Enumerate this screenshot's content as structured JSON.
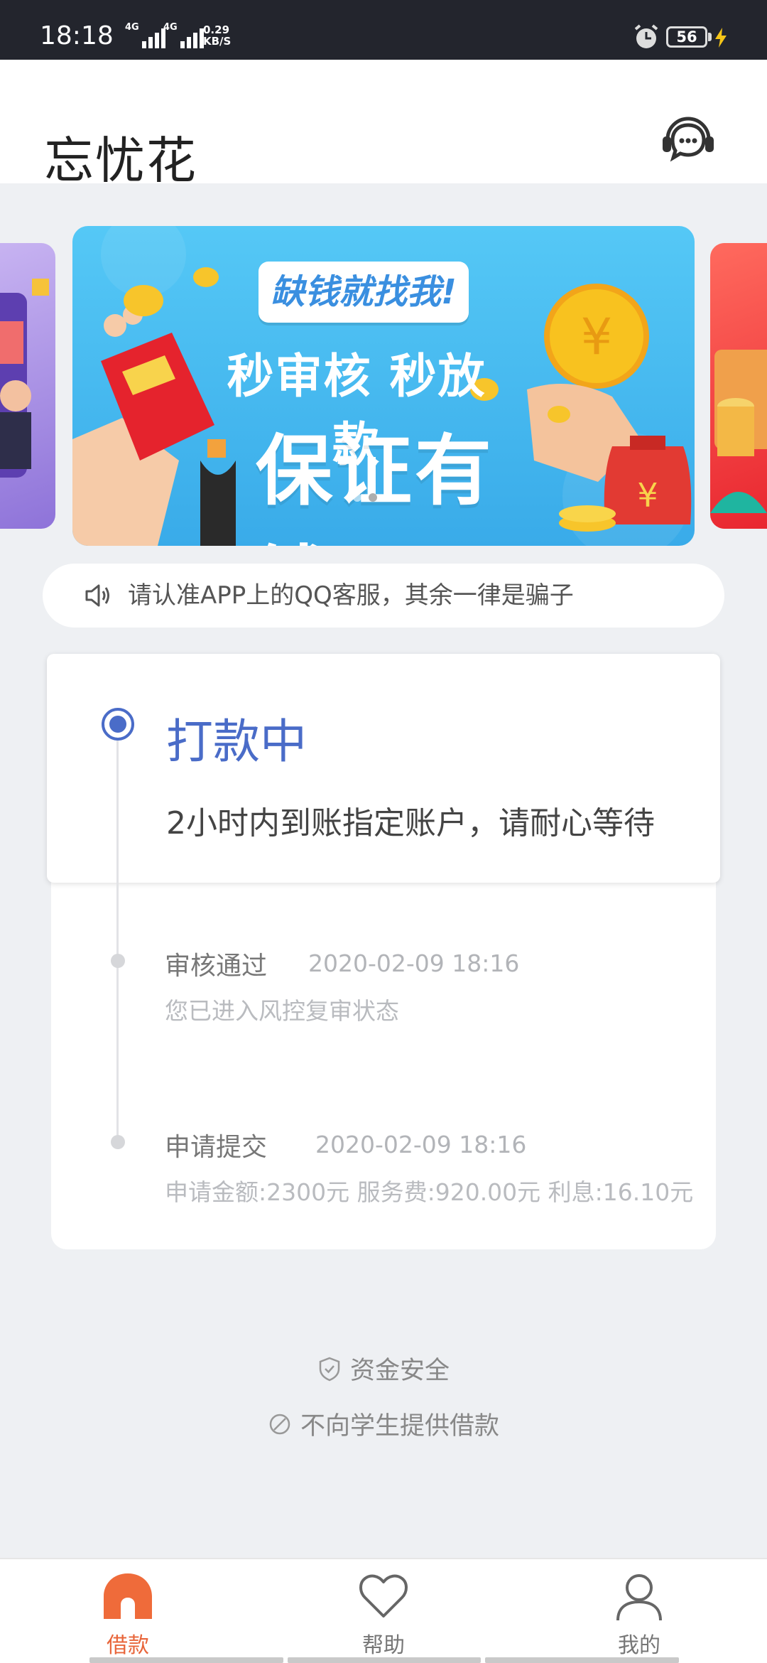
{
  "status_bar": {
    "time": "18:18",
    "signal1_label": "4G",
    "signal2_label": "4G",
    "net_speed_value": "0.29",
    "net_speed_unit": "KB/S",
    "battery": "56"
  },
  "header": {
    "title": "忘忧花",
    "support_icon": "customer-service-headset-icon"
  },
  "banner": {
    "tagline": "缺钱就找我!",
    "line2": "秒审核 秒放款",
    "line3": "保证有钱"
  },
  "notice": {
    "icon": "speaker-icon",
    "text": "请认准APP上的QQ客服，其余一律是骗子"
  },
  "current_status": {
    "title": "打款中",
    "description": "2小时内到账指定账户，请耐心等待",
    "accent": "#4a6cc8"
  },
  "history": [
    {
      "title": "审核通过",
      "time": "2020-02-09 18:16",
      "description": "您已进入风控复审状态"
    },
    {
      "title": "申请提交",
      "time": "2020-02-09 18:16",
      "description": "申请金额:2300元  服务费:920.00元 利息:16.10元"
    }
  ],
  "footer": {
    "safe_text": "资金安全",
    "student_text": "不向学生提供借款"
  },
  "tabs": [
    {
      "label": "借款",
      "icon": "home-icon",
      "active": true
    },
    {
      "label": "帮助",
      "icon": "heart-icon",
      "active": false
    },
    {
      "label": "我的",
      "icon": "user-icon",
      "active": false
    }
  ],
  "colors": {
    "active_tab": "#e8653a",
    "status_bar": "#23252d"
  }
}
